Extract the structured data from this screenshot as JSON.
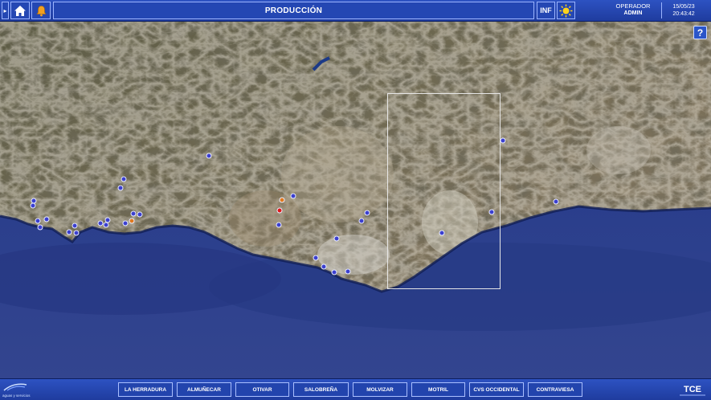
{
  "header": {
    "menu_toggle": "▸",
    "home_icon": "home-icon",
    "alarm_icon": "bell-icon",
    "title": "PRODUCCIÓN",
    "inf_label": "INF",
    "weather_icon": "sun-icon",
    "user_role": "OPERADOR",
    "user_name": "ADMIN",
    "date": "15/05/23",
    "time": "20:43:42"
  },
  "map": {
    "help_label": "?",
    "marker_colors": {
      "station": "#3b3fcf",
      "warning": "#e07a1f",
      "alarm": "#e01515"
    }
  },
  "footer": {
    "left_brand": "aguas y servicios",
    "right_brand": "TCE",
    "zones": [
      {
        "label": "LA HERRADURA"
      },
      {
        "label": "ALMUÑECAR"
      },
      {
        "label": "OTIVAR"
      },
      {
        "label": "SALOBREÑA"
      },
      {
        "label": "MOLVIZAR"
      },
      {
        "label": "MOTRIL"
      },
      {
        "label": "CVS OCCIDENTAL"
      },
      {
        "label": "CONTRAVIESA"
      }
    ]
  }
}
